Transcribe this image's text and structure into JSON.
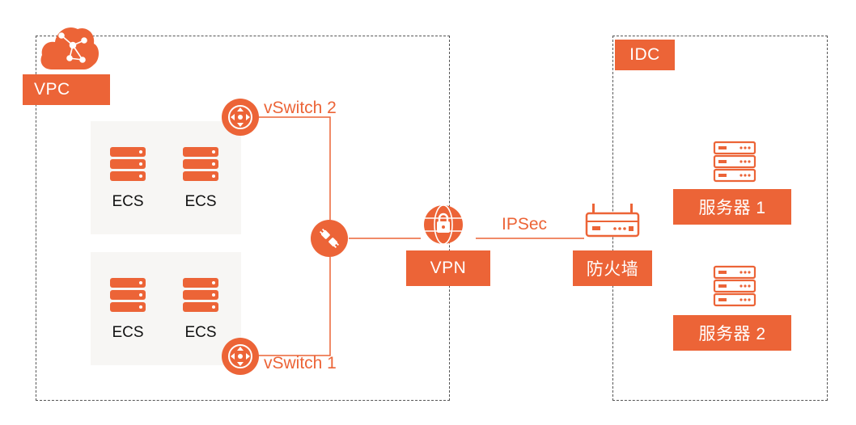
{
  "vpc": {
    "label": "VPC",
    "ecs_groups": [
      [
        "ECS",
        "ECS"
      ],
      [
        "ECS",
        "ECS"
      ]
    ],
    "vswitch_top": "vSwitch 2",
    "vswitch_bottom": "vSwitch 1"
  },
  "vpn": {
    "label": "VPN"
  },
  "link": {
    "label": "IPSec"
  },
  "idc": {
    "label": "IDC",
    "firewall_label": "防火墙",
    "servers": [
      "服务器 1",
      "服务器 2"
    ]
  },
  "colors": {
    "accent": "#ec6437",
    "line": "#ec6437",
    "border": "#555555"
  },
  "icons": [
    "cloud-icon",
    "server-stack-icon",
    "vswitch-icon",
    "router-plug-icon",
    "vpn-globe-lock-icon",
    "firewall-device-icon"
  ]
}
